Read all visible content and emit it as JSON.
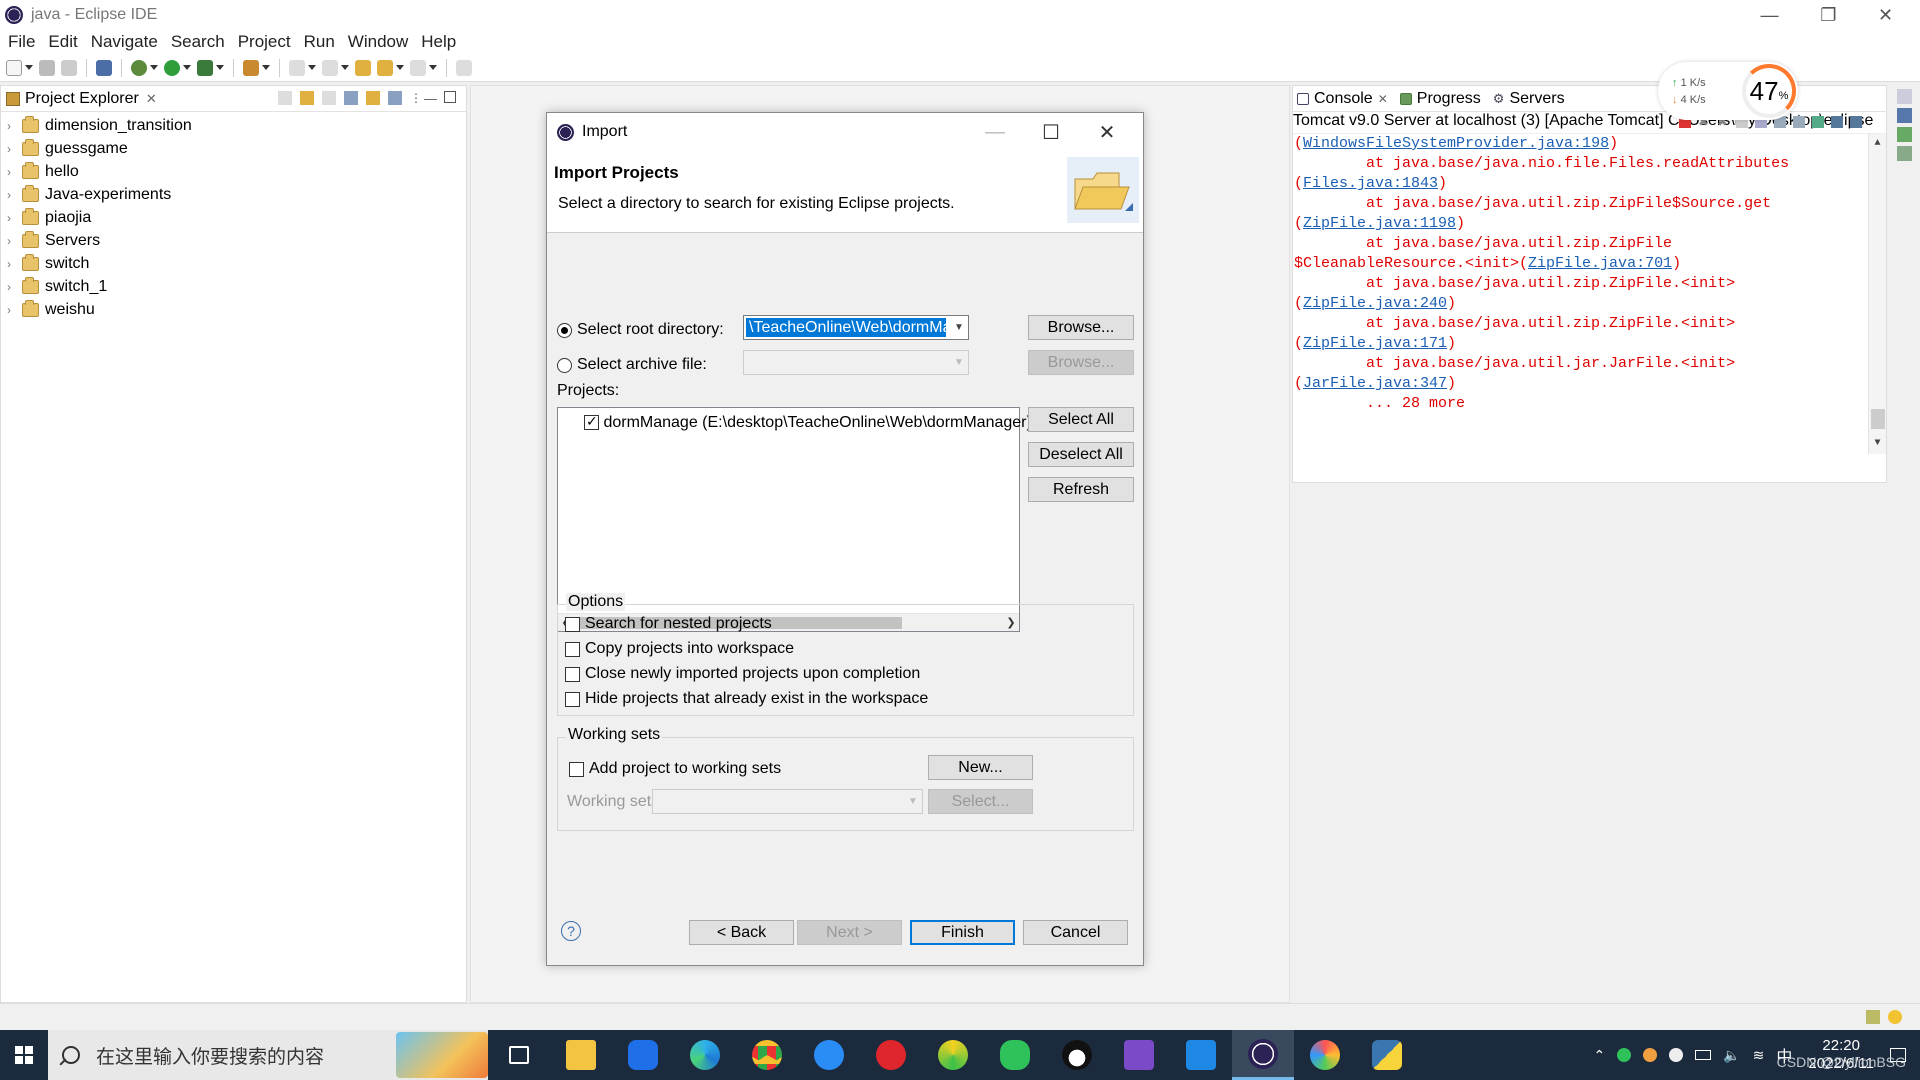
{
  "window": {
    "title": "java - Eclipse IDE"
  },
  "menu": [
    "File",
    "Edit",
    "Navigate",
    "Search",
    "Project",
    "Run",
    "Window",
    "Help"
  ],
  "project_explorer": {
    "title": "Project Explorer",
    "projects": [
      "dimension_transition",
      "guessgame",
      "hello",
      "Java-experiments",
      "piaojia",
      "Servers",
      "switch",
      "switch_1",
      "weishu"
    ]
  },
  "console": {
    "tabs": [
      "Console",
      "Progress",
      "Servers"
    ],
    "description": "Tomcat v9.0 Server at localhost (3) [Apache Tomcat] C:\\Users\\my\\Desktop\\eclipse",
    "lines": [
      {
        "pre": "(",
        "link": "WindowsFileSystemProvider.java:198",
        "post": ")"
      },
      {
        "pre": "        at java.base/java.nio.file.Files.readAttributes",
        "link": "",
        "post": ""
      },
      {
        "pre": "(",
        "link": "Files.java:1843",
        "post": ")"
      },
      {
        "pre": "        at java.base/java.util.zip.ZipFile$Source.get",
        "link": "",
        "post": ""
      },
      {
        "pre": "(",
        "link": "ZipFile.java:1198",
        "post": ")"
      },
      {
        "pre": "        at java.base/java.util.zip.ZipFile",
        "link": "",
        "post": ""
      },
      {
        "pre": "$CleanableResource.<init>(",
        "link": "ZipFile.java:701",
        "post": ")"
      },
      {
        "pre": "        at java.base/java.util.zip.ZipFile.<init>",
        "link": "",
        "post": ""
      },
      {
        "pre": "(",
        "link": "ZipFile.java:240",
        "post": ")"
      },
      {
        "pre": "        at java.base/java.util.zip.ZipFile.<init>",
        "link": "",
        "post": ""
      },
      {
        "pre": "(",
        "link": "ZipFile.java:171",
        "post": ")"
      },
      {
        "pre": "        at java.base/java.util.jar.JarFile.<init>",
        "link": "",
        "post": ""
      },
      {
        "pre": "(",
        "link": "JarFile.java:347",
        "post": ")"
      },
      {
        "pre": "        ... 28 more",
        "link": "",
        "post": ""
      }
    ]
  },
  "speed_widget": {
    "up": "1  K/s",
    "down": "4  K/s",
    "percent": "47",
    "unit": "%"
  },
  "dialog": {
    "title": "Import",
    "heading": "Import Projects",
    "description": "Select a directory to search for existing Eclipse projects.",
    "root_dir_label": "Select root directory:",
    "root_dir_value": "\\TeacheOnline\\Web\\dormManger",
    "archive_label": "Select archive file:",
    "browse": "Browse...",
    "projects_label": "Projects:",
    "project_item": "dormManage (E:\\desktop\\TeacheOnline\\Web\\dormManager)",
    "select_all": "Select All",
    "deselect_all": "Deselect All",
    "refresh": "Refresh",
    "options_label": "Options",
    "options": [
      "Search for nested projects",
      "Copy projects into workspace",
      "Close newly imported projects upon completion",
      "Hide projects that already exist in the workspace"
    ],
    "working_sets_label": "Working sets",
    "add_to_ws": "Add project to working sets",
    "new_btn": "New...",
    "ws_field_label": "Working sets:",
    "select_btn": "Select...",
    "help": "?",
    "back": "< Back",
    "next": "Next >",
    "finish": "Finish",
    "cancel": "Cancel"
  },
  "taskbar": {
    "search_placeholder": "在这里输入你要搜索的内容",
    "time": "22:20",
    "date": "2022/6/11",
    "ime": "中",
    "watermark": "CSDN @DyllionBSG"
  },
  "colors": {
    "accent": "#0078d7",
    "console_error": "#e00000",
    "console_link": "#1a5fb4",
    "taskbar": "#1b2a3c"
  }
}
